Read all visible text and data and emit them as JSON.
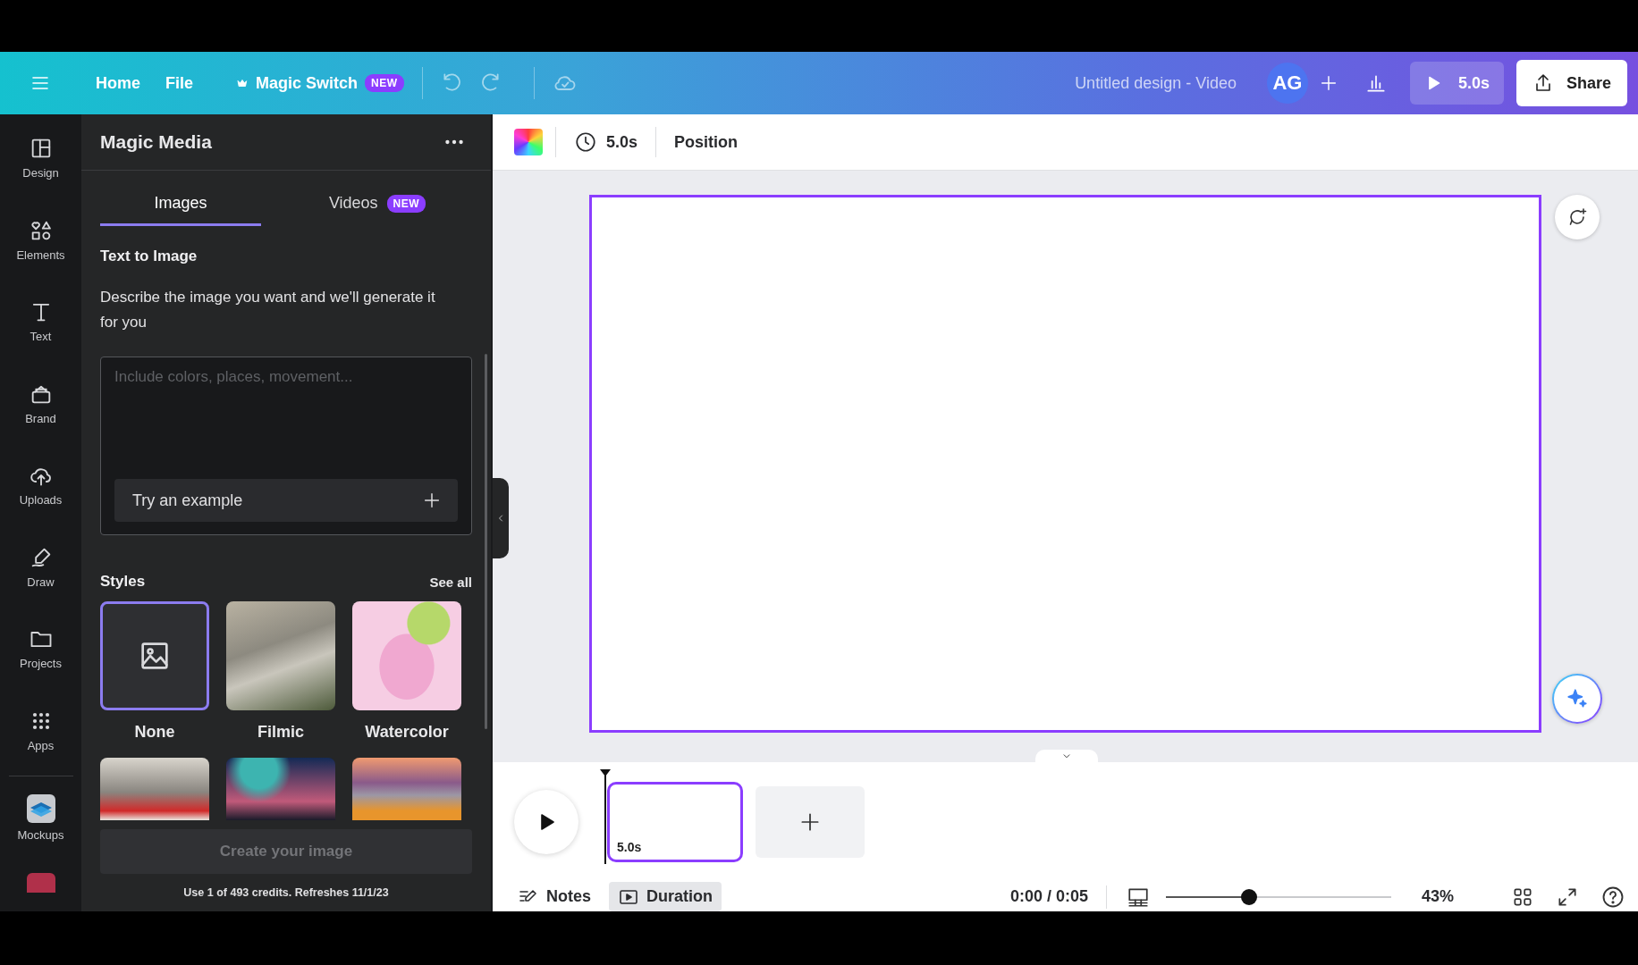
{
  "header": {
    "menu": [
      {
        "label": "Home"
      },
      {
        "label": "File"
      }
    ],
    "magic_switch": {
      "label": "Magic Switch",
      "badge": "NEW"
    },
    "design_title": "Untitled design - Video",
    "avatar": "AG",
    "play": {
      "label": "5.0s"
    },
    "share": {
      "label": "Share"
    }
  },
  "rail": [
    {
      "label": "Design",
      "kind": "design"
    },
    {
      "label": "Elements",
      "kind": "elements"
    },
    {
      "label": "Text",
      "kind": "text"
    },
    {
      "label": "Brand",
      "kind": "brand"
    },
    {
      "label": "Uploads",
      "kind": "uploads"
    },
    {
      "label": "Draw",
      "kind": "draw"
    },
    {
      "label": "Projects",
      "kind": "projects"
    },
    {
      "label": "Apps",
      "kind": "apps"
    },
    {
      "label": "Mockups",
      "kind": "mockups"
    },
    {
      "kind": "photo"
    }
  ],
  "panel": {
    "title": "Magic Media",
    "tabs": [
      {
        "label": "Images",
        "selected": true
      },
      {
        "label": "Videos",
        "badge": "NEW",
        "selected": false
      }
    ],
    "section_title": "Text to Image",
    "description": "Describe the image you want and we'll generate it for you",
    "prompt": {
      "placeholder": "Include colors, places, movement..."
    },
    "example_button": "Try an example",
    "styles_title": "Styles",
    "see_all": "See all",
    "styles": [
      {
        "label": "None",
        "kind": "none",
        "selected": true
      },
      {
        "label": "Filmic",
        "kind": "photo",
        "selected": false
      },
      {
        "label": "Watercolor",
        "kind": "photo",
        "selected": false
      },
      {
        "kind": "photo",
        "selected": false
      },
      {
        "kind": "photo",
        "selected": false
      },
      {
        "kind": "photo",
        "selected": false
      }
    ],
    "create_button": {
      "label": "Create your image",
      "disabled": true
    },
    "credits": "Use 1 of 493 credits. Refreshes 11/1/23"
  },
  "toolbar": {
    "duration": "5.0s",
    "position": "Position"
  },
  "timeline": {
    "clips": [
      {
        "duration": "5.0s",
        "selected": true
      }
    ]
  },
  "footer": {
    "notes": "Notes",
    "duration": {
      "label": "Duration",
      "selected": true
    },
    "time": "0:00 / 0:05",
    "zoom": {
      "level": 0.37,
      "reading": "43%"
    }
  }
}
